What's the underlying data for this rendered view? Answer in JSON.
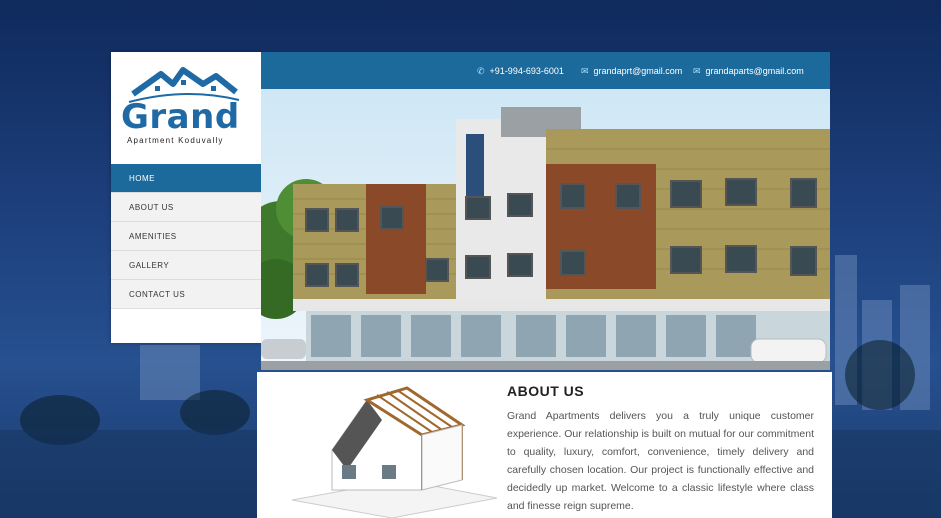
{
  "logo": {
    "word": "Grand",
    "tagline": "Apartment Koduvally"
  },
  "nav": {
    "items": [
      {
        "label": "HOME",
        "active": true
      },
      {
        "label": "ABOUT US",
        "active": false
      },
      {
        "label": "AMENITIES",
        "active": false
      },
      {
        "label": "GALLERY",
        "active": false
      },
      {
        "label": "CONTACT US",
        "active": false
      }
    ]
  },
  "contact": {
    "phone": "+91-994-693-6001",
    "email1": "grandaprt@gmail.com",
    "email2": "grandaparts@gmail.com",
    "icons": [
      "phone-icon",
      "mail-icon",
      "mail-icon"
    ]
  },
  "about": {
    "title": "ABOUT US",
    "text": "Grand Apartments delivers you a truly unique customer experience. Our relationship is built on mutual for our commitment to quality, luxury, comfort, convenience, timely delivery and carefully chosen location. Our project is functionally effective and decidedly up market. Welcome to a classic lifestyle where class and finesse reign supreme."
  },
  "colors": {
    "brand": "#1c6a9c",
    "logo": "#1f6aa5",
    "background": "#1d3f7c"
  }
}
